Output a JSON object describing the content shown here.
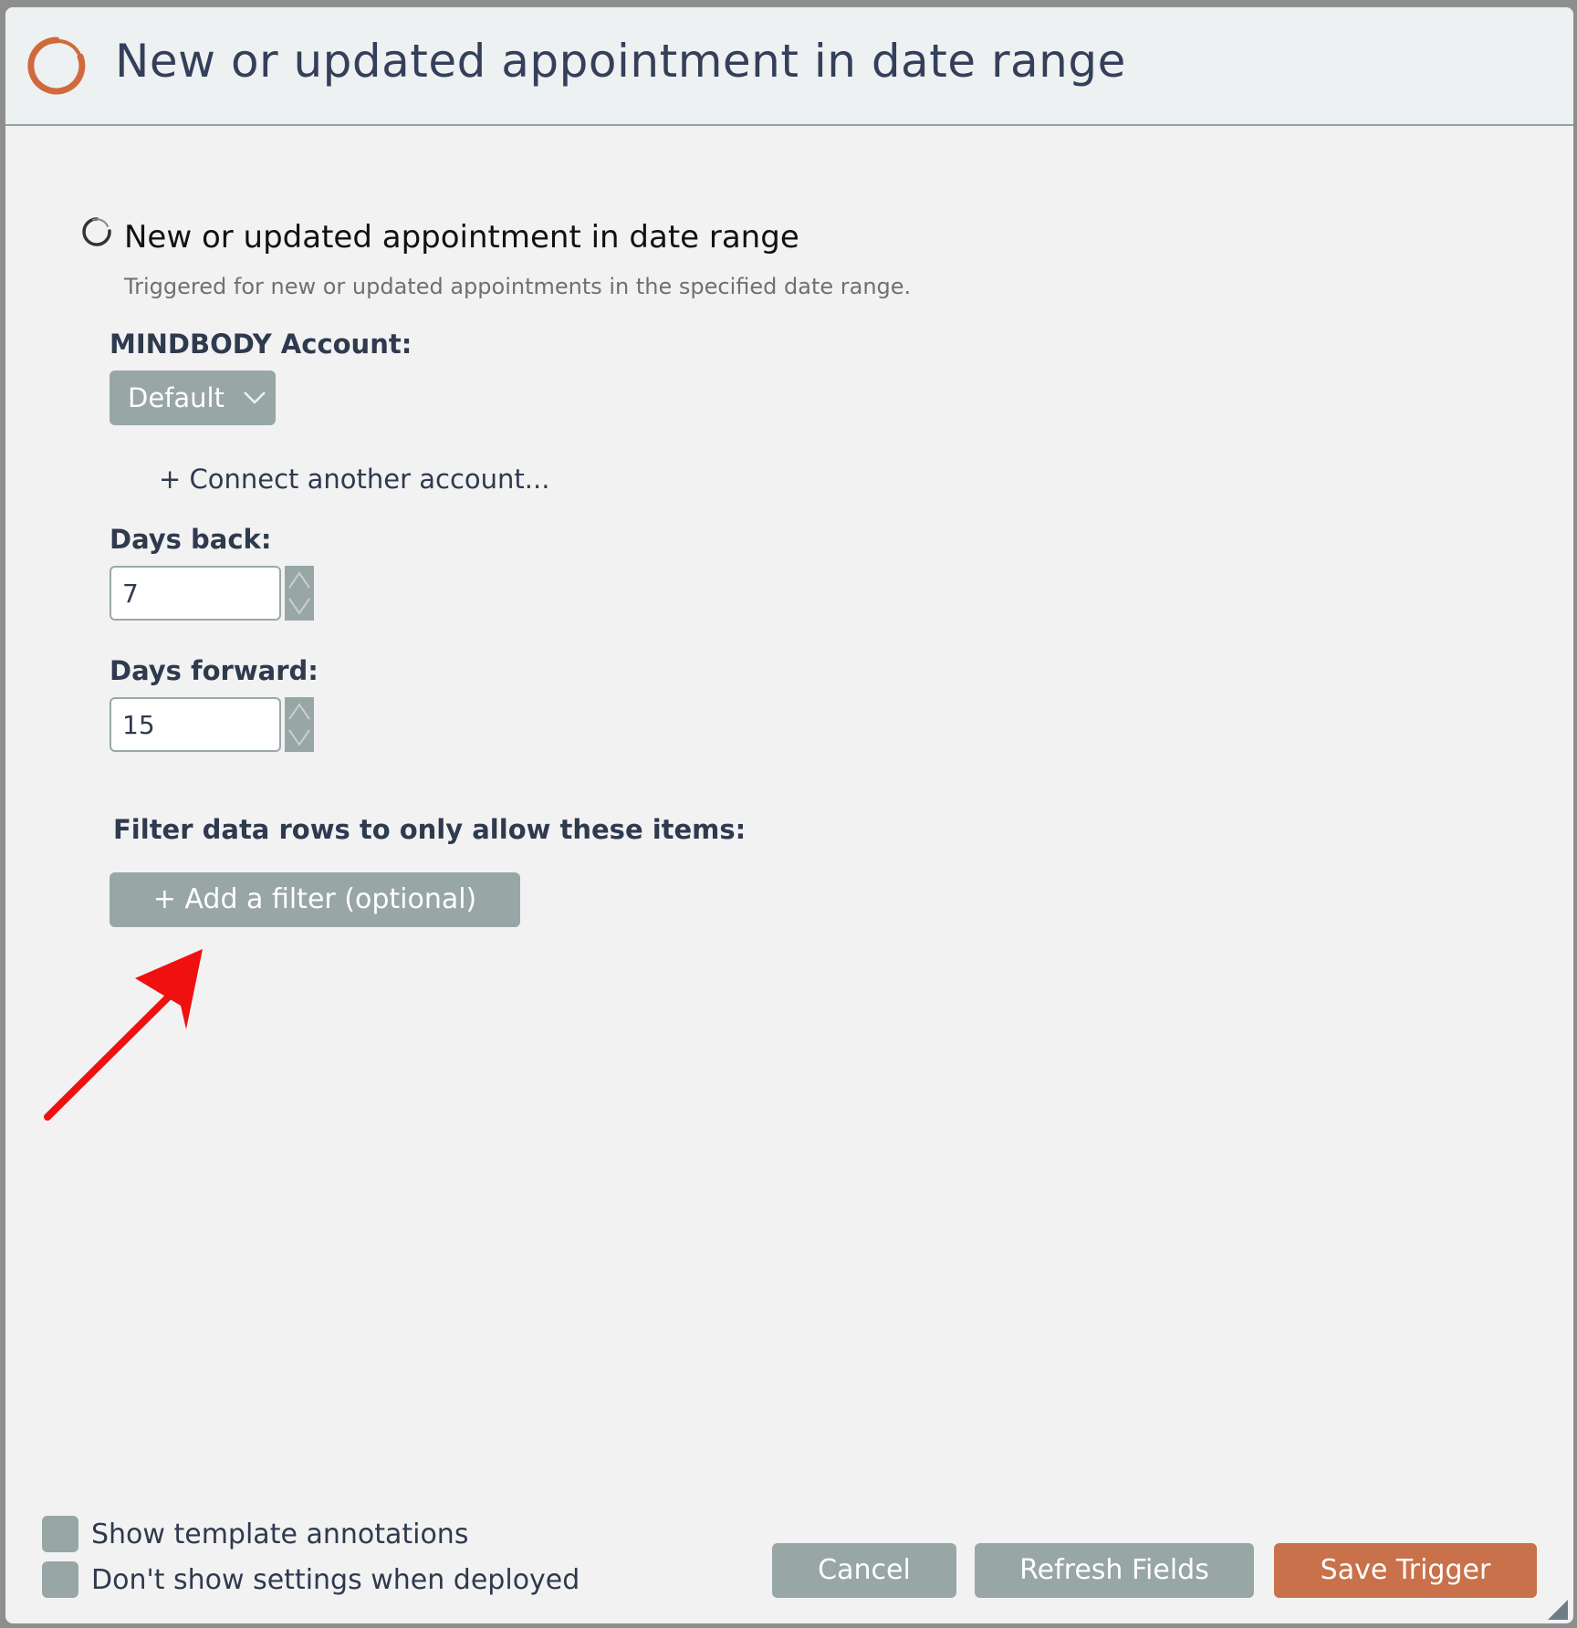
{
  "header": {
    "title": "New or updated appointment in date range",
    "logo_icon": "ring-logo-icon",
    "accent_color": "#d06a3c"
  },
  "trigger": {
    "icon": "spinner-ring-icon",
    "name": "New or updated appointment in date range",
    "description": "Triggered for new or updated appointments in the specified date range."
  },
  "account": {
    "label": "MINDBODY Account:",
    "selected": "Default",
    "connect_link": "+ Connect another account..."
  },
  "days_back": {
    "label": "Days back:",
    "value": "7"
  },
  "days_forward": {
    "label": "Days forward:",
    "value": "15"
  },
  "filter": {
    "label": "Filter data rows to only allow these items:",
    "add_button": "+ Add a filter (optional)"
  },
  "annotation": {
    "icon": "red-arrow-icon",
    "color": "#f01010"
  },
  "options": {
    "show_annotations": "Show template annotations",
    "hide_settings": "Don't show settings when deployed"
  },
  "footer": {
    "cancel": "Cancel",
    "refresh": "Refresh Fields",
    "save": "Save Trigger",
    "save_color": "#c8714a"
  }
}
